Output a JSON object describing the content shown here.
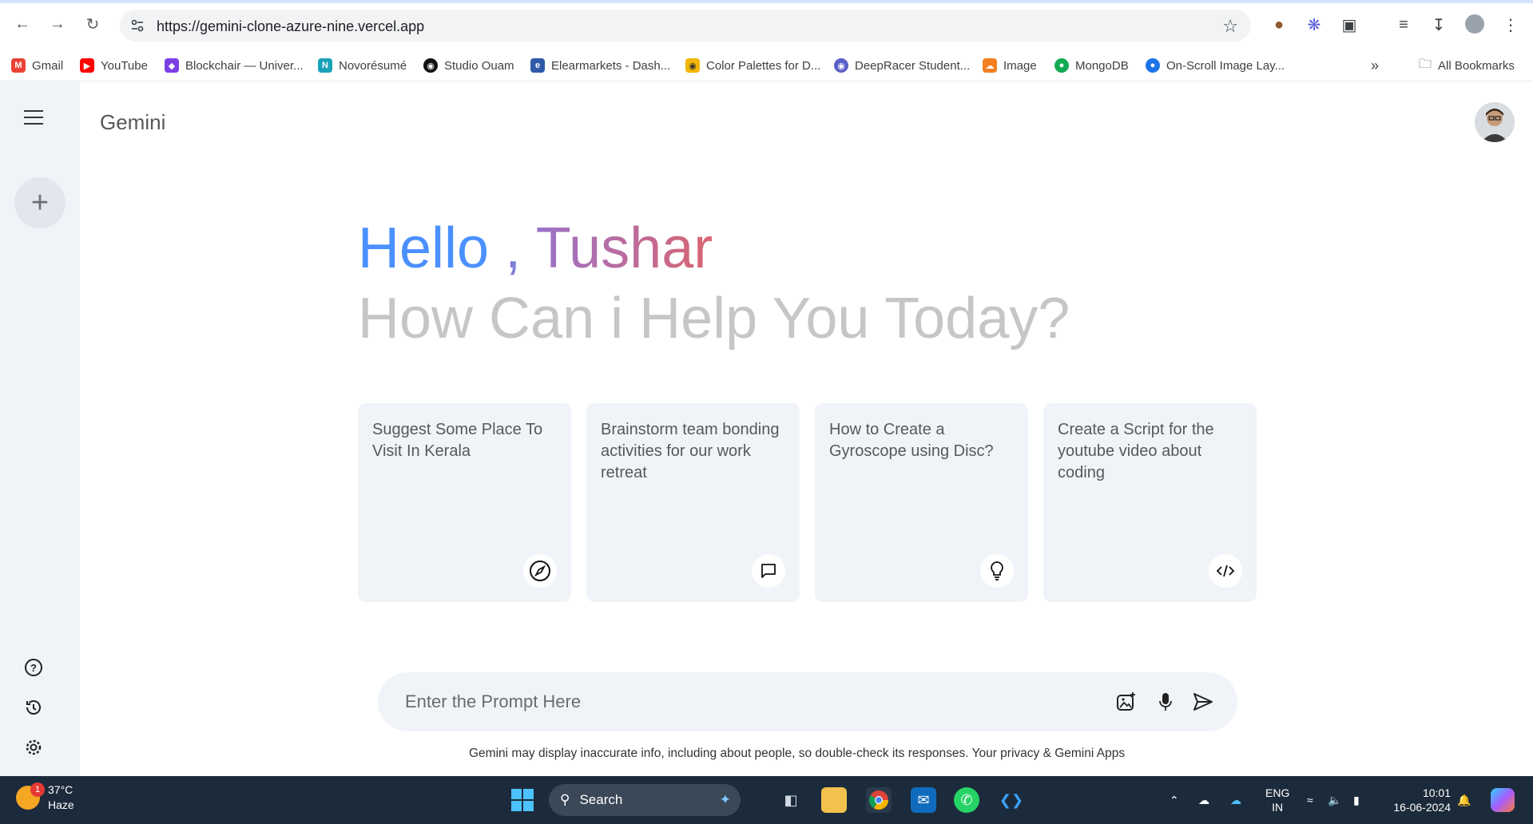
{
  "browser": {
    "url": "https://gemini-clone-azure-nine.vercel.app",
    "bookmarks": [
      {
        "label": "Gmail",
        "icon": "gmail-icon",
        "color": "#ea4335"
      },
      {
        "label": "YouTube",
        "icon": "youtube-icon",
        "color": "#ff0000"
      },
      {
        "label": "Blockchair — Univer...",
        "icon": "blockchair-icon",
        "color": "#7b3fe4"
      },
      {
        "label": "Novorésumé",
        "icon": "novoresume-icon",
        "color": "#1aa3b8"
      },
      {
        "label": "Studio Ouam",
        "icon": "studio-icon",
        "color": "#111111"
      },
      {
        "label": "Elearmarkets - Dash...",
        "icon": "elearn-icon",
        "color": "#2f5aa8"
      },
      {
        "label": "Color Palettes for D...",
        "icon": "palette-icon",
        "color": "#f2b705"
      },
      {
        "label": "DeepRacer Student...",
        "icon": "deepracer-icon",
        "color": "#5b5fc7"
      },
      {
        "label": "Image",
        "icon": "cloud-icon",
        "color": "#f38020"
      },
      {
        "label": "MongoDB",
        "icon": "mongodb-icon",
        "color": "#13aa52"
      },
      {
        "label": "On-Scroll Image Lay...",
        "icon": "onscroll-icon",
        "color": "#1a73e8"
      }
    ],
    "all_bookmarks": "All Bookmarks"
  },
  "app": {
    "title": "Gemini",
    "greeting_hello": "Hello",
    "greeting_comma": " , ",
    "greeting_name": "Tushar",
    "subheading": "How Can i Help You Today?",
    "cards": [
      {
        "text": "Suggest Some Place To Visit In Kerala",
        "icon": "compass-icon"
      },
      {
        "text": "Brainstorm team bonding activities for our work retreat",
        "icon": "message-icon"
      },
      {
        "text": "How to Create a Gyroscope using Disc?",
        "icon": "bulb-icon"
      },
      {
        "text": "Create a Script for the youtube video about coding",
        "icon": "code-icon"
      }
    ],
    "prompt_placeholder": "Enter the Prompt Here",
    "disclaimer": "Gemini may display inaccurate info, including about people, so double-check its responses. Your privacy & Gemini Apps"
  },
  "taskbar": {
    "temperature": "37°C",
    "weather": "Haze",
    "weather_badge": "1",
    "search_label": "Search",
    "lang_top": "ENG",
    "lang_bottom": "IN",
    "time": "10:01",
    "date": "16-06-2024"
  }
}
